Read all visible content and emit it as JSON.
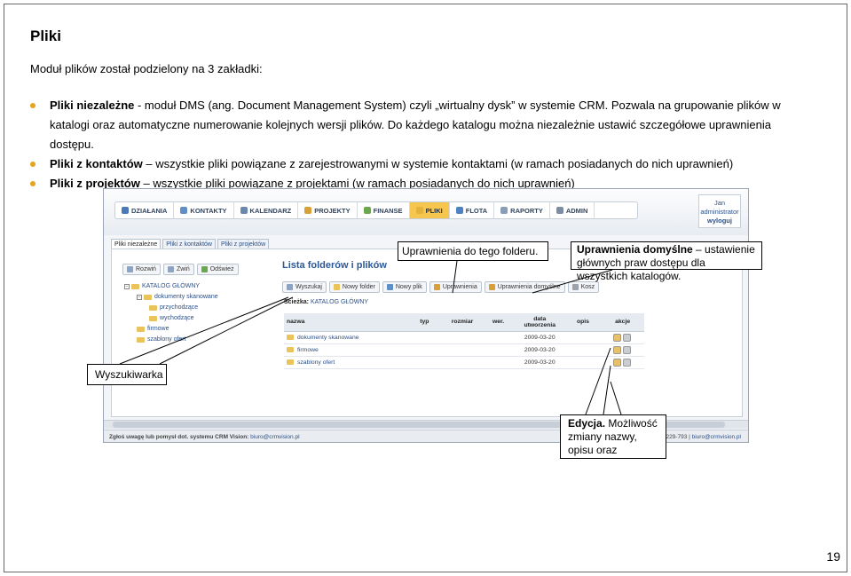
{
  "document": {
    "title": "Pliki",
    "intro": "Moduł plików został podzielony na 3 zakładki:",
    "bullets": [
      {
        "bold": "Pliki niezależne",
        "text": " -  moduł DMS (ang. Document Management System) czyli „wirtualny dysk” w systemie CRM. Pozwala na grupowanie plików w katalogi oraz automatyczne numerowanie kolejnych wersji plików. Do każdego katalogu można niezależnie ustawić szczegółowe uprawnienia dostępu."
      },
      {
        "bold": "Pliki z kontaktów",
        "text": " – wszystkie pliki powiązane z zarejestrowanymi w systemie kontaktami (w ramach posiadanych do nich uprawnień)"
      },
      {
        "bold": "Pliki z projektów",
        "text": " – wszystkie pliki powiązane z projektami (w ramach posiadanych do nich uprawnień)"
      }
    ],
    "page_number": "19"
  },
  "app": {
    "nav": [
      {
        "label": "DZIAŁANIA",
        "color": "#4a78b8"
      },
      {
        "label": "KONTAKTY",
        "color": "#5f8fc9"
      },
      {
        "label": "KALENDARZ",
        "color": "#6a88ad"
      },
      {
        "label": "PROJEKTY",
        "color": "#d9a03a"
      },
      {
        "label": "FINANSE",
        "color": "#6aa84f"
      },
      {
        "label": "PLIKI",
        "color": "#e2b23a"
      },
      {
        "label": "FLOTA",
        "color": "#4d83c4"
      },
      {
        "label": "RAPORTY",
        "color": "#8a9db7"
      },
      {
        "label": "ADMIN",
        "color": "#7b8ca3"
      }
    ],
    "user": {
      "name": "Jan",
      "role": "administrator",
      "logout": "wyloguj"
    },
    "tabs": [
      "Pliki niezależne",
      "Pliki z kontaktów",
      "Pliki z projektów"
    ],
    "tree_toolbar": [
      "Rozwiń",
      "Zwiń",
      "Odśwież"
    ],
    "tree": [
      {
        "label": "KATALOG GŁÓWNY",
        "level": 0
      },
      {
        "label": "dokumenty skanowane",
        "level": 1
      },
      {
        "label": "przychodzące",
        "level": 2
      },
      {
        "label": "wychodzące",
        "level": 2
      },
      {
        "label": "firmowe",
        "level": 1
      },
      {
        "label": "szablony ofert",
        "level": 1
      }
    ],
    "panel_title": "Lista folderów i plików",
    "file_toolbar": [
      "Wyszukaj",
      "Nowy folder",
      "Nowy plik",
      "Uprawnienia",
      "Uprawnienia domyślne",
      "Kosz"
    ],
    "breadcrumb_label": "Ścieżka:",
    "breadcrumb_path": "KATALOG GŁÓWNY",
    "columns": [
      "nazwa",
      "typ",
      "rozmiar",
      "wer.",
      "data utworzenia",
      "opis",
      "akcje"
    ],
    "rows": [
      {
        "name": "dokumenty skanowane",
        "date": "2009-03-20"
      },
      {
        "name": "firmowe",
        "date": "2009-03-20"
      },
      {
        "name": "szablony ofert",
        "date": "2009-03-20"
      }
    ],
    "status_left": "Zgłoś uwagę lub pomysł dot. systemu CRM Vision:",
    "status_left_email": "biuro@crmvision.pl",
    "status_right_tel": "229-793",
    "status_right_email": "biuro@crmvision.pl"
  },
  "callouts": {
    "folder_perms": "Uprawnienia do tego folderu.",
    "default_perms_bold": "Uprawnienia domyślne",
    "default_perms_text": " – ustawienie głównych praw dostępu dla wszystkich katalogów.",
    "search": "Wyszukiwarka",
    "edit_bold": "Edycja.",
    "edit_text": " Możliwość zmiany nazwy, opisu oraz uprawnień."
  }
}
